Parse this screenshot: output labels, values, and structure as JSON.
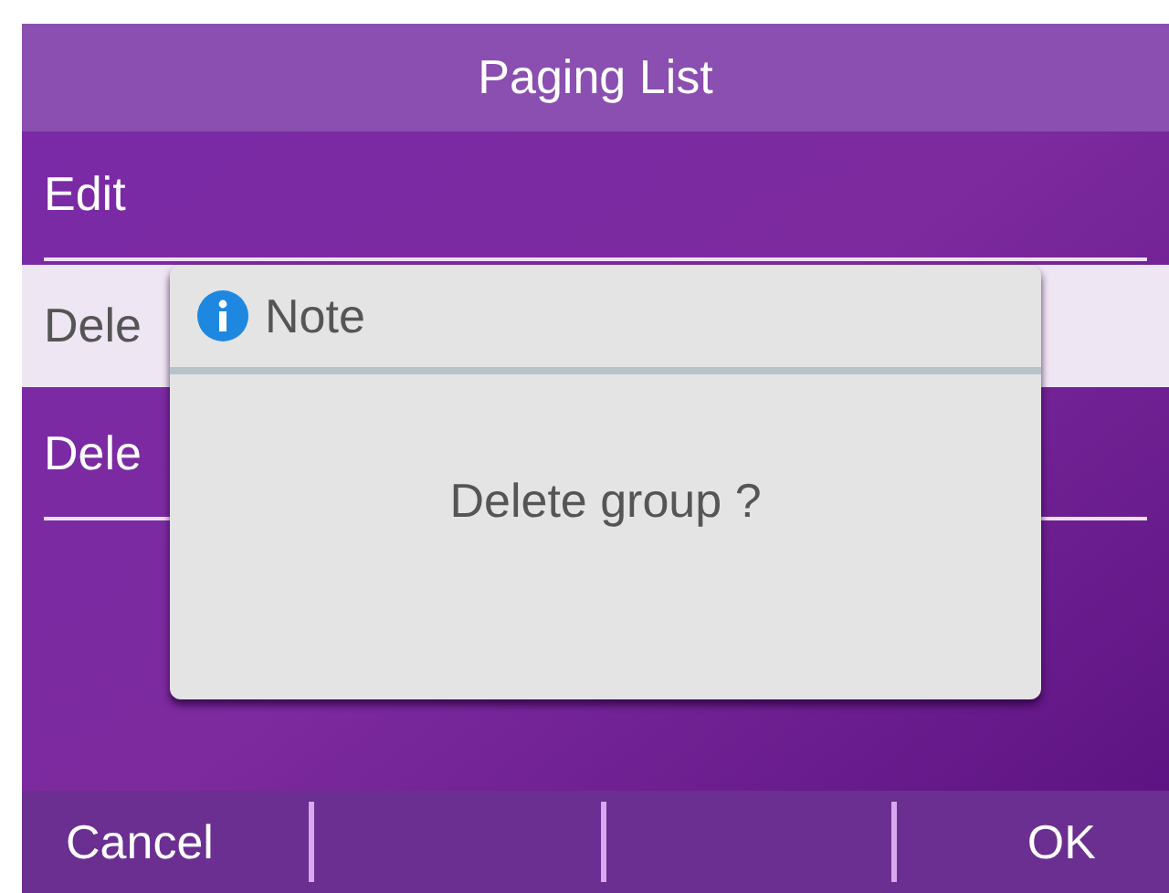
{
  "title": "Paging List",
  "items": [
    {
      "label": "Edit",
      "selected": false
    },
    {
      "label": "Dele",
      "selected": true
    },
    {
      "label": "Dele",
      "selected": false
    }
  ],
  "dialog": {
    "title": "Note",
    "message": "Delete group ?"
  },
  "softkeys": {
    "left": "Cancel",
    "right": "OK"
  }
}
